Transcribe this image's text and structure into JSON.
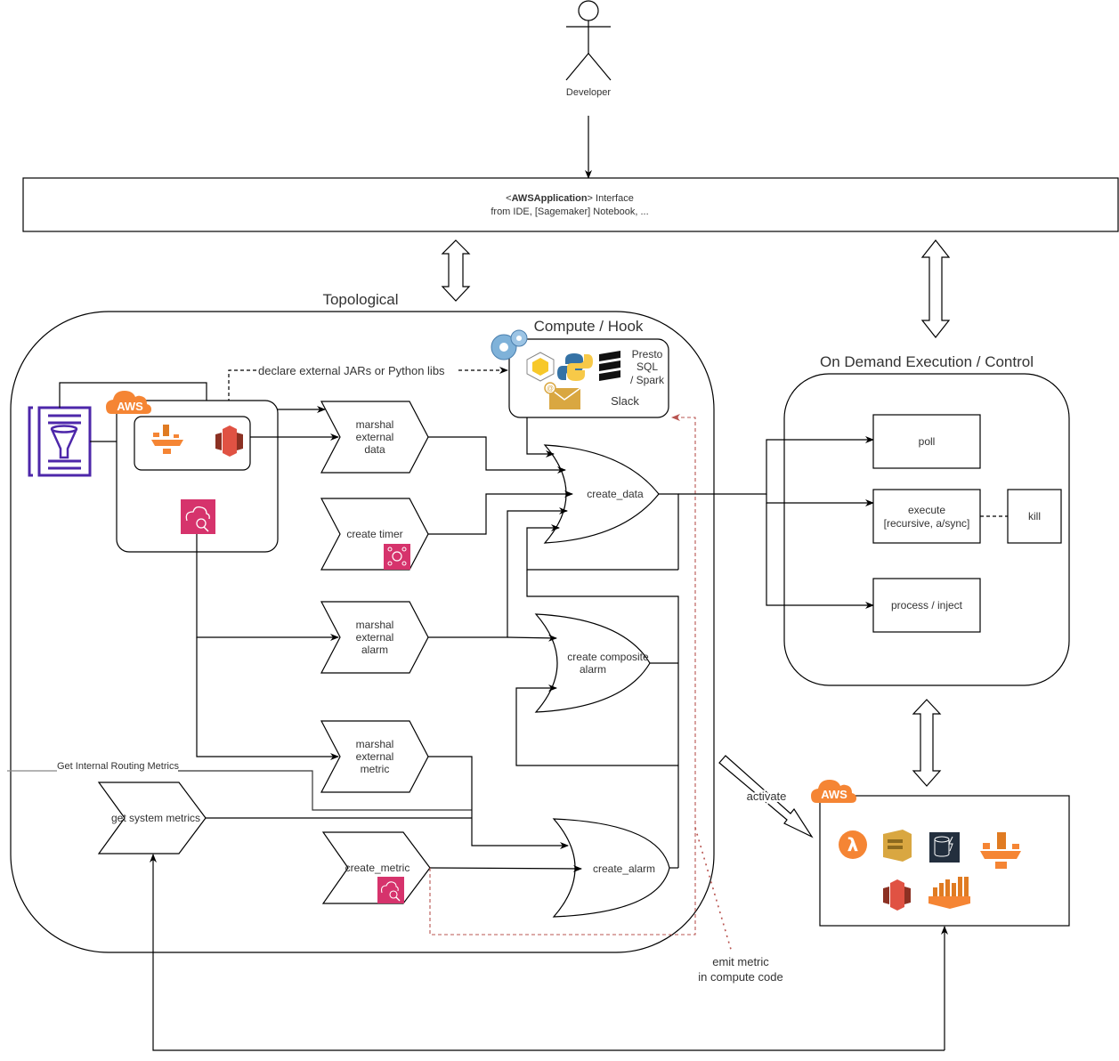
{
  "actor": {
    "label": "Developer"
  },
  "interface": {
    "prefix": "<",
    "name": "AWSApplication",
    "suffix": "> Interface",
    "subtitle": "from IDE, [Sagemaker] Notebook, ..."
  },
  "topological": {
    "title": "Topological",
    "compute_hook": {
      "title": "Compute / Hook",
      "engines": [
        "Presto",
        "SQL",
        "/ Spark"
      ],
      "notify": "Slack",
      "declare_label": "declare external JARs or Python libs"
    },
    "aws_badge": "AWS",
    "nodes": {
      "marshal_data": [
        "marshal",
        "external",
        "data"
      ],
      "create_timer": "create timer",
      "marshal_alarm": [
        "marshal",
        "external",
        "alarm"
      ],
      "marshal_metric": [
        "marshal",
        "external",
        "metric"
      ],
      "get_system_metrics": "get system metrics",
      "create_metric": "create_metric"
    },
    "gates": {
      "create_data": "create_data",
      "create_composite_alarm": [
        "create composite",
        "alarm"
      ],
      "create_alarm": "create_alarm"
    },
    "routing_label": "Get Internal Routing Metrics",
    "emit_label": [
      "emit metric",
      "in compute code"
    ]
  },
  "on_demand": {
    "title": "On Demand Execution / Control",
    "poll": "poll",
    "execute": [
      "execute",
      "[recursive, a/sync]"
    ],
    "kill": "kill",
    "process": "process / inject"
  },
  "activate_label": "activate",
  "aws_runtime": {
    "badge": "AWS"
  },
  "colors": {
    "aws_orange": "#F58534",
    "s3_red": "#E05243",
    "cloudwatch_pink": "#D6336C",
    "sqs_gold": "#D9A741",
    "redash_red": "#b85450",
    "catalog_purple": "#4D27AA"
  }
}
